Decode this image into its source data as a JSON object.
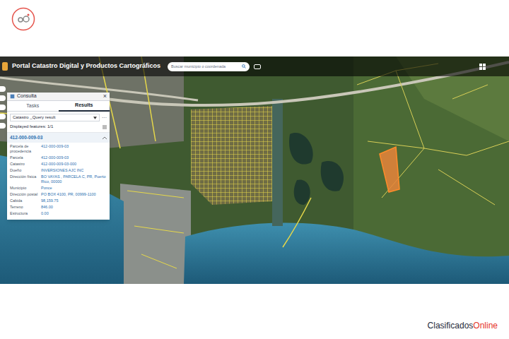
{
  "portal": {
    "title": "Portal Catastro Digital y Productos Cartográficos",
    "search": {
      "placeholder": "Buscar municipio o coordenada"
    }
  },
  "panel": {
    "title": "Consulta",
    "close": "×",
    "tabs": [
      {
        "label": "Tasks",
        "selected": false
      },
      {
        "label": "Results",
        "selected": true
      }
    ],
    "layer": "Catastro _Query result",
    "menu": "···",
    "displayed": "Displayed features: 1/1",
    "feature": {
      "id": "412-000-009-03",
      "expanded": true,
      "fields": [
        {
          "label": "Parcela de procedencia",
          "value": "412-000-009-03"
        },
        {
          "label": "Parcela",
          "value": "412-000-009-03"
        },
        {
          "label": "Catastro",
          "value": "412-000-009-03-000"
        },
        {
          "label": "Dueño",
          "value": "INVERSIONES AJC INC"
        },
        {
          "label": "Dirección física",
          "value": "BO VAYAS , PARCELA C, PR, Puerto Rico, 00000"
        },
        {
          "label": "Municipio",
          "value": "Ponce"
        },
        {
          "label": "Dirección postal",
          "value": "PO BOX 4100, PR, 00999-1100"
        },
        {
          "label": "Cabida",
          "value": "98,159.75"
        },
        {
          "label": "Terreno",
          "value": "846.00"
        },
        {
          "label": "Estructura",
          "value": "0.00"
        }
      ]
    }
  },
  "brand": {
    "name": "Clasificados",
    "suffix": "Online"
  }
}
